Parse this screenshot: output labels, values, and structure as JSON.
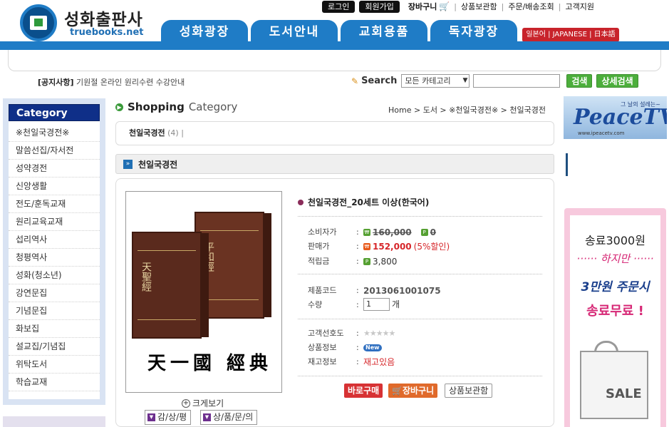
{
  "header": {
    "logo_name": "성화출판사",
    "logo_domain": "truebooks.net",
    "login": "로그인",
    "join": "회원가입",
    "cart": "장바구니",
    "links": [
      "상품보관함",
      "주문/배송조회",
      "고객지원"
    ],
    "tabs": [
      "성화광장",
      "도서안내",
      "교회용품",
      "독자광장"
    ],
    "lang": "일본어 | JAPANESE | 日本語"
  },
  "notice": {
    "label": "[공지사항]",
    "text": "기원절 온라인 원리수련 수강안내"
  },
  "search": {
    "label": "Search",
    "category_value": "모든 카테고리",
    "input_value": "",
    "search_button": "검색",
    "detail_button": "상세검색"
  },
  "sidebar": {
    "heading": "Category",
    "items": [
      "※천일국경전※",
      "말씀선집/자서전",
      "성약경전",
      "신앙생활",
      "전도/훈독교재",
      "원리교육교재",
      "섭리역사",
      "청평역사",
      "성화(청소년)",
      "강연문집",
      "기념문집",
      "화보집",
      "설교집/기념집",
      "위탁도서",
      "학습교재"
    ]
  },
  "main": {
    "title_strong": "Shopping",
    "title_light": "Category",
    "breadcrumb": "Home > 도서 > ※천일국경전※ > 천일국경전",
    "category_name": "천일국경전",
    "category_count": "(4)",
    "section_title": "천일국경전"
  },
  "product": {
    "name": "천일국경전_20세트 이상(한국어)",
    "image_caption": "天一國 經典",
    "book_front_title": "天聖經",
    "book_back_title": "平和經",
    "consumer_label": "소비자가",
    "consumer_price": "160,000",
    "consumer_point": "0",
    "sale_label": "판매가",
    "sale_price": "152,000",
    "sale_discount": "(5%할인)",
    "point_label": "적립금",
    "point": "3,800",
    "code_label": "제품코드",
    "code": "2013061001075",
    "qty_label": "수량",
    "qty": "1",
    "qty_unit": "개",
    "pref_label": "고객선호도",
    "info_label": "상품정보",
    "info_badge": "New",
    "stock_label": "재고정보",
    "stock": "재고있음",
    "buy_button": "바로구매",
    "cart_button": "장바구니",
    "keep_button": "상품보관함",
    "zoom": "크게보기",
    "review_button": "감/상/평",
    "qna_button": "상/품/문/의"
  },
  "right": {
    "peacetv_slogan": "그 날의 설레는~",
    "peacetv_logo": "PeaceTV",
    "peacetv_url": "www.ipeacetv.com",
    "promo_line1": "송료3000원",
    "promo_line2": "······ 하지만 ······",
    "promo_line3": "3만원 주문시",
    "promo_line4": "송료무료 !",
    "promo_sale": "SALE"
  }
}
